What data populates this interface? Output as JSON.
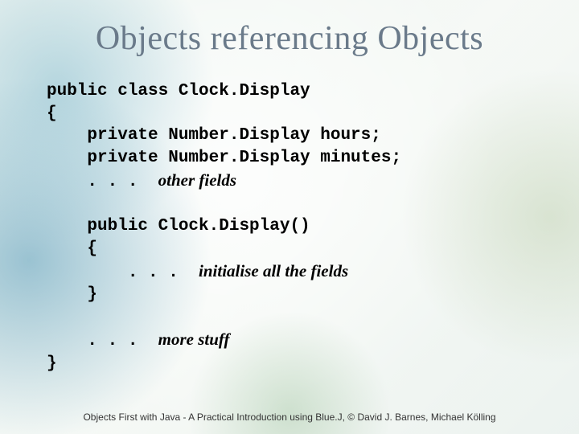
{
  "title": "Objects referencing Objects",
  "code": {
    "l1": "public class Clock.Display",
    "l2": "{",
    "l3": "    private Number.Display hours;",
    "l4": "    private Number.Display minutes;",
    "l5a": "    . . .  ",
    "l5b": "other fields",
    "l6": "",
    "l7": "    public Clock.Display()",
    "l8": "    {",
    "l9a": "        . . .  ",
    "l9b": "initialise all the fields",
    "l10": "    }",
    "l11": "",
    "l12a": "    . . .  ",
    "l12b": "more stuff",
    "l13": "}"
  },
  "footer": "Objects First with Java - A Practical Introduction using Blue.J, © David J. Barnes, Michael Kölling"
}
